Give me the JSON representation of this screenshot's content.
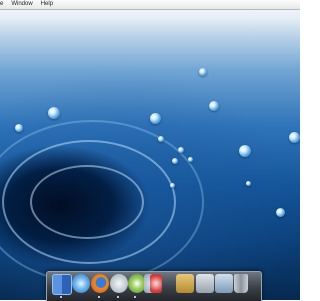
{
  "menubar": {
    "items": [
      "e",
      "Window",
      "Help"
    ]
  },
  "colors": {
    "water_light": "#e6eef6",
    "water_mid": "#2f74b9",
    "water_dark": "#06294f",
    "dock": "#3a4048"
  },
  "dock": {
    "icons": [
      {
        "name": "finder-icon",
        "color": "#3d78d0"
      },
      {
        "name": "safari-icon",
        "color": "#4aa0e6"
      },
      {
        "name": "firefox-icon",
        "color": "#e06a1c"
      },
      {
        "name": "mail-icon",
        "color": "#c7ccd3"
      },
      {
        "name": "itunes-icon",
        "color": "#7fb43c"
      },
      {
        "name": "ichat-icon",
        "color": "#8fa0b2"
      },
      {
        "name": "dashboard-icon",
        "color": "#d23a3a"
      },
      {
        "name": "applications-folder-icon",
        "color": "#c9a24a"
      },
      {
        "name": "documents-folder-icon",
        "color": "#a9b3be"
      },
      {
        "name": "downloads-folder-icon",
        "color": "#9fb6cc"
      },
      {
        "name": "trash-icon",
        "color": "#9ba4ad"
      }
    ]
  }
}
